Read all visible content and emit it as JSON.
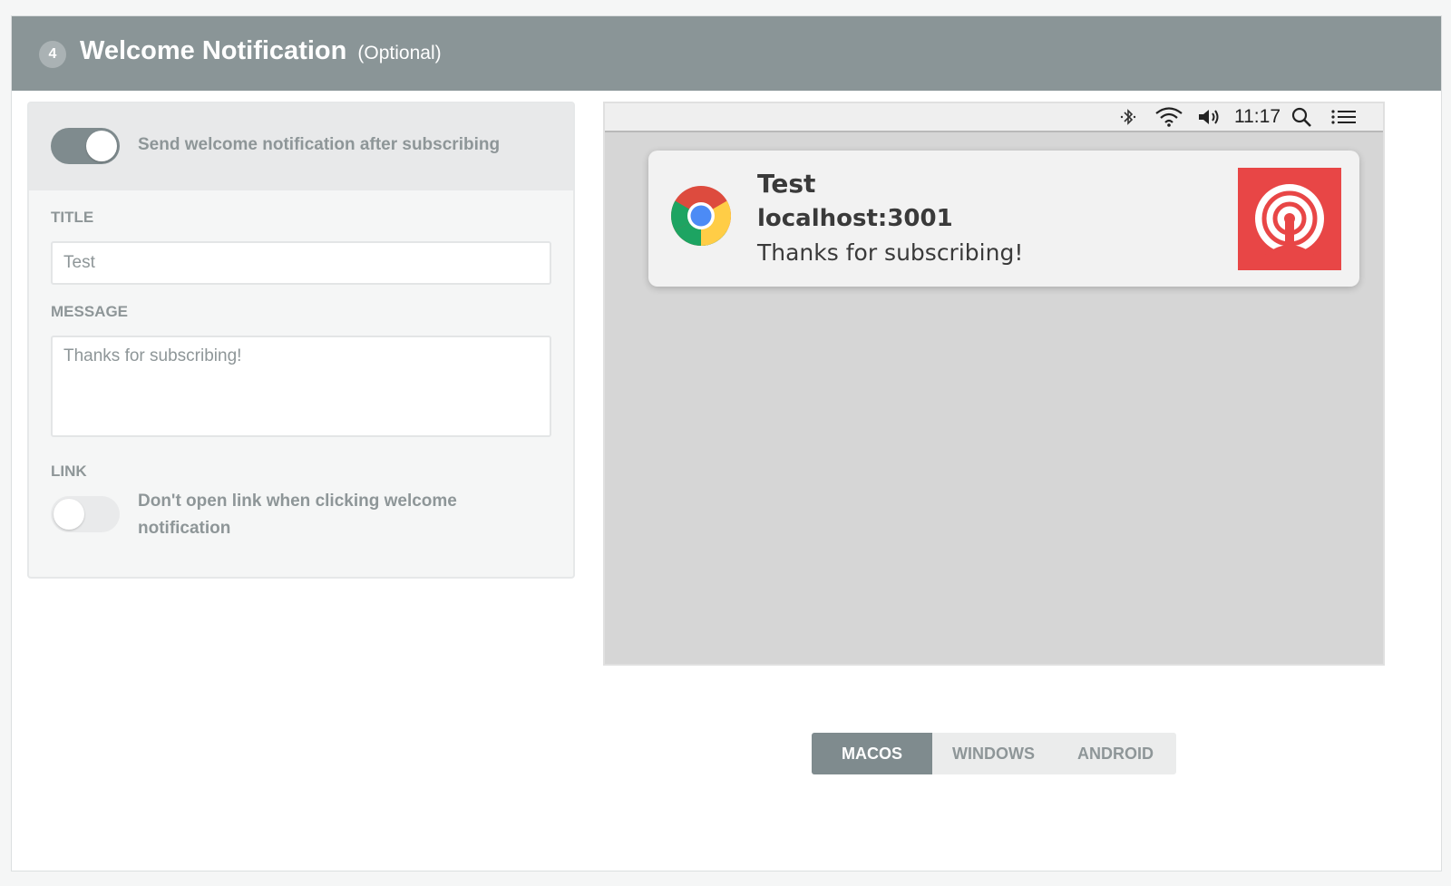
{
  "header": {
    "step_number": "4",
    "title": "Welcome Notification",
    "optional_label": "(Optional)"
  },
  "settings": {
    "send_toggle": {
      "enabled": true,
      "label": "Send welcome notification after subscribing"
    },
    "title_field": {
      "label": "TITLE",
      "value": "Test",
      "placeholder": ""
    },
    "message_field": {
      "label": "MESSAGE",
      "value": "Thanks for subscribing!"
    },
    "link": {
      "label": "LINK",
      "toggle_enabled": false,
      "toggle_label_line1": "Don't open link when clicking welcome",
      "toggle_label_line2": "notification"
    }
  },
  "preview": {
    "menubar": {
      "time": "11:17",
      "icons": [
        "bluetooth-icon",
        "wifi-icon",
        "volume-icon",
        "search-icon",
        "list-icon"
      ]
    },
    "notification": {
      "browser_icon": "chrome-logo-icon",
      "title": "Test",
      "origin": "localhost:3001",
      "body": "Thanks for subscribing!",
      "image_icon": "broadcast-icon",
      "image_color": "#e84646"
    }
  },
  "platform_tabs": {
    "selected": "MACOS",
    "items": [
      {
        "label": "MACOS"
      },
      {
        "label": "WINDOWS"
      },
      {
        "label": "ANDROID"
      }
    ]
  },
  "colors": {
    "header_bg": "#8a9597",
    "accent_gray": "#7f8b8e",
    "label_gray": "#8e9698",
    "preview_bg": "#d6d6d6"
  }
}
